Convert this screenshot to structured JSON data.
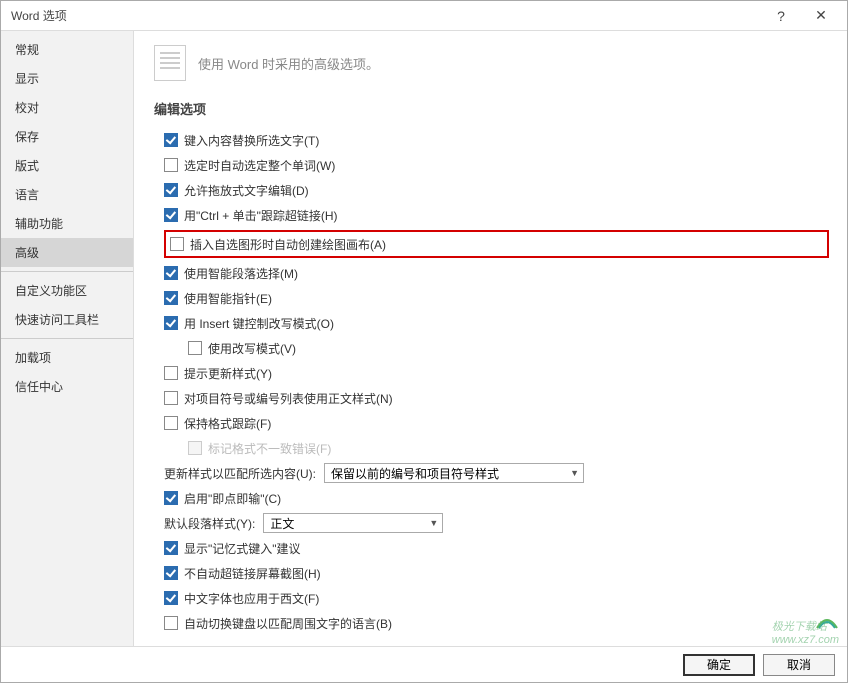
{
  "title": "Word 选项",
  "sidebar": {
    "items": [
      {
        "label": "常规"
      },
      {
        "label": "显示"
      },
      {
        "label": "校对"
      },
      {
        "label": "保存"
      },
      {
        "label": "版式"
      },
      {
        "label": "语言"
      },
      {
        "label": "辅助功能"
      },
      {
        "label": "高级",
        "selected": true
      },
      {
        "label": "自定义功能区"
      },
      {
        "label": "快速访问工具栏"
      },
      {
        "label": "加载项"
      },
      {
        "label": "信任中心"
      }
    ]
  },
  "header": {
    "text": "使用 Word 时采用的高级选项。"
  },
  "section": {
    "title": "编辑选项"
  },
  "options": {
    "opt0": {
      "label": "键入内容替换所选文字(T)",
      "checked": true
    },
    "opt1": {
      "label": "选定时自动选定整个单词(W)",
      "checked": false
    },
    "opt2": {
      "label": "允许拖放式文字编辑(D)",
      "checked": true
    },
    "opt3": {
      "label": "用\"Ctrl + 单击\"跟踪超链接(H)",
      "checked": true
    },
    "opt4": {
      "label": "插入自选图形时自动创建绘图画布(A)",
      "checked": false,
      "highlight": true
    },
    "opt5": {
      "label": "使用智能段落选择(M)",
      "checked": true
    },
    "opt6": {
      "label": "使用智能指针(E)",
      "checked": true
    },
    "opt7": {
      "label": "用 Insert 键控制改写模式(O)",
      "checked": true
    },
    "opt7a": {
      "label": "使用改写模式(V)",
      "checked": false,
      "indent": true
    },
    "opt8": {
      "label": "提示更新样式(Y)",
      "checked": false
    },
    "opt9": {
      "label": "对项目符号或编号列表使用正文样式(N)",
      "checked": false
    },
    "opt10": {
      "label": "保持格式跟踪(F)",
      "checked": false
    },
    "opt10a": {
      "label": "标记格式不一致错误(F)",
      "checked": false,
      "disabled": true,
      "indent": true
    },
    "opt11": {
      "label": "启用\"即点即输\"(C)",
      "checked": true
    },
    "opt12": {
      "label": "显示\"记忆式键入\"建议",
      "checked": true
    },
    "opt13": {
      "label": "不自动超链接屏幕截图(H)",
      "checked": true
    },
    "opt14": {
      "label": "中文字体也应用于西文(F)",
      "checked": true
    },
    "opt15": {
      "label": "自动切换键盘以匹配周围文字的语言(B)",
      "checked": false
    }
  },
  "combos": {
    "style_update": {
      "label": "更新样式以匹配所选内容(U):",
      "value": "保留以前的编号和项目符号样式"
    },
    "default_para": {
      "label": "默认段落样式(Y):",
      "value": "正文"
    }
  },
  "footer": {
    "ok": "确定",
    "cancel": "取消"
  },
  "watermark": {
    "text": "极光下载站",
    "url": "www.xz7.com"
  }
}
